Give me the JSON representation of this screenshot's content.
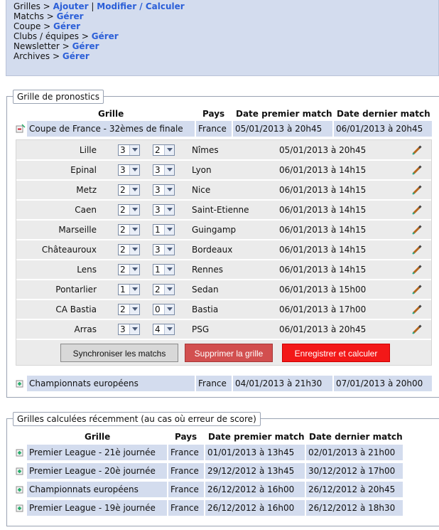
{
  "nav": [
    {
      "label": "Grilles >",
      "links": [
        "Ajouter",
        "Modifier / Calculer"
      ]
    },
    {
      "label": "Matchs >",
      "links": [
        "Gérer"
      ]
    },
    {
      "label": "Coupe >",
      "links": [
        "Gérer"
      ]
    },
    {
      "label": "Clubs / équipes >",
      "links": [
        "Gérer"
      ]
    },
    {
      "label": "Newsletter >",
      "links": [
        "Gérer"
      ]
    },
    {
      "label": "Archives >",
      "links": [
        "Gérer"
      ]
    }
  ],
  "nav_separator": "|",
  "pronostics": {
    "legend": "Grille de pronostics",
    "headers": {
      "grille": "Grille",
      "pays": "Pays",
      "first": "Date premier match",
      "last": "Date dernier match"
    },
    "grids": [
      {
        "name": "Coupe de France - 32èmes de finale",
        "country": "France",
        "first": "05/01/2013 à 20h45",
        "last": "06/01/2013 à 20h45",
        "expanded": true
      },
      {
        "name": "Championnats européens",
        "country": "France",
        "first": "04/01/2013 à 21h30",
        "last": "07/01/2013 à 20h00",
        "expanded": false
      }
    ],
    "matches": [
      {
        "home": "Lille",
        "home_score": "3",
        "sep": "-",
        "away_score": "2",
        "away": "Nîmes",
        "date": "05/01/2013 à 20h45"
      },
      {
        "home": "Epinal",
        "home_score": "3",
        "sep": "-",
        "away_score": "3",
        "away": "Lyon",
        "date": "06/01/2013 à 14h15"
      },
      {
        "home": "Metz",
        "home_score": "2",
        "sep": "-",
        "away_score": "3",
        "away": "Nice",
        "date": "06/01/2013 à 14h15"
      },
      {
        "home": "Caen",
        "home_score": "2",
        "sep": "-",
        "away_score": "3",
        "away": "Saint-Etienne",
        "date": "06/01/2013 à 14h15"
      },
      {
        "home": "Marseille",
        "home_score": "2",
        "sep": "-",
        "away_score": "1",
        "away": "Guingamp",
        "date": "06/01/2013 à 14h15"
      },
      {
        "home": "Châteauroux",
        "home_score": "2",
        "sep": "-",
        "away_score": "3",
        "away": "Bordeaux",
        "date": "06/01/2013 à 14h15"
      },
      {
        "home": "Lens",
        "home_score": "2",
        "sep": "-",
        "away_score": "1",
        "away": "Rennes",
        "date": "06/01/2013 à 14h15"
      },
      {
        "home": "Pontarlier",
        "home_score": "1",
        "sep": "-",
        "away_score": "2",
        "away": "Sedan",
        "date": "06/01/2013 à 15h00"
      },
      {
        "home": "CA Bastia",
        "home_score": "2",
        "sep": "-",
        "away_score": "0",
        "away": "Bastia",
        "date": "06/01/2013 à 17h00"
      },
      {
        "home": "Arras",
        "home_score": "3",
        "sep": "-",
        "away_score": "4",
        "away": "PSG",
        "date": "06/01/2013 à 20h45"
      }
    ],
    "buttons": {
      "sync": "Synchroniser les matchs",
      "delete": "Supprimer la grille",
      "save": "Enregistrer et calculer"
    }
  },
  "recent": {
    "legend": "Grilles calculées récemment (au cas où erreur de score)",
    "headers": {
      "grille": "Grille",
      "pays": "Pays",
      "first": "Date premier match",
      "last": "Date dernier match"
    },
    "grids": [
      {
        "name": "Premier League - 21è journée",
        "country": "France",
        "first": "01/01/2013 à 13h45",
        "last": "02/01/2013 à 21h00"
      },
      {
        "name": "Premier League - 20è journée",
        "country": "France",
        "first": "29/12/2012 à 13h45",
        "last": "30/12/2012 à 17h00"
      },
      {
        "name": "Championnats européens",
        "country": "France",
        "first": "26/12/2012 à 16h00",
        "last": "26/12/2012 à 20h45"
      },
      {
        "name": "Premier League - 19è journée",
        "country": "France",
        "first": "26/12/2012 à 16h00",
        "last": "26/12/2012 à 18h30"
      }
    ]
  },
  "colors": {
    "panel": "#d3dcee",
    "link": "#2b5fd8",
    "save": "#f31818",
    "delete": "#d24f4f"
  },
  "icons": {
    "expand": "expand-plus-icon",
    "collapse": "collapse-minus-icon",
    "edit": "pencil-icon"
  }
}
